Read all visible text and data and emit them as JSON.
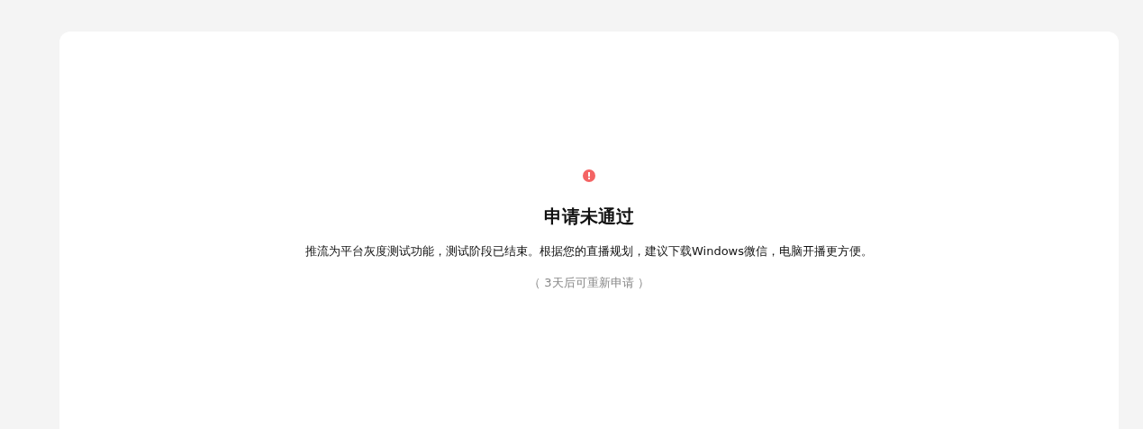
{
  "result": {
    "error": true,
    "title": "申请未通过",
    "message": "推流为平台灰度测试功能，测试阶段已结束。根据您的直播规划，建议下载Windows微信，电脑开播更方便。",
    "note": "（ 3天后可重新申请 ）"
  }
}
